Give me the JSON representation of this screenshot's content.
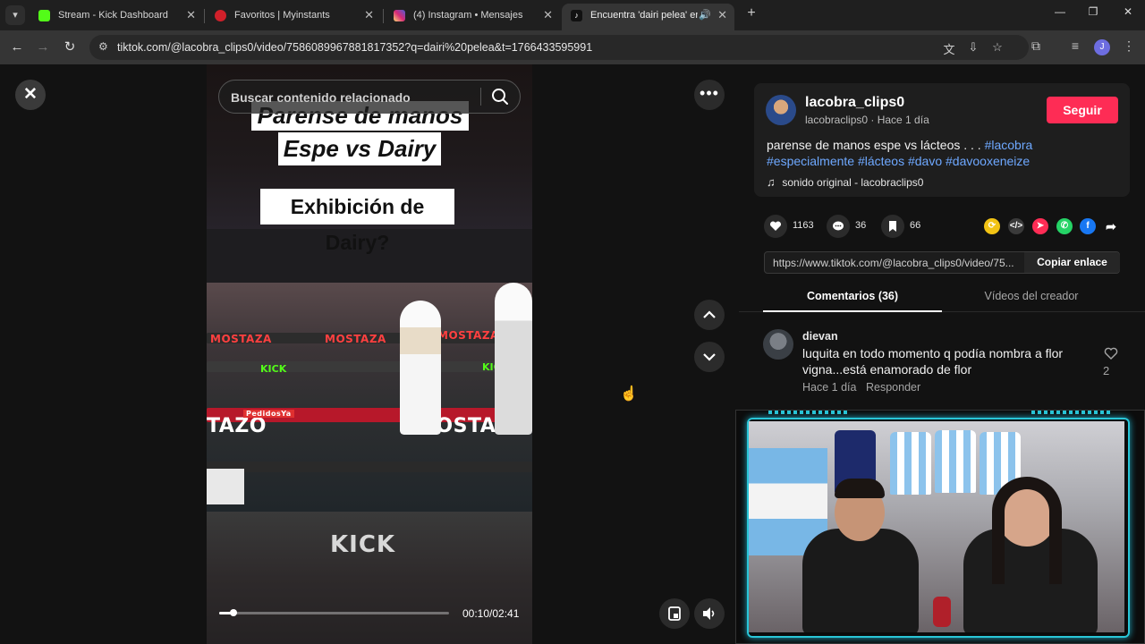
{
  "browser": {
    "tabs": [
      {
        "title": "Stream - Kick Dashboard",
        "color": "#53fc18"
      },
      {
        "title": "Favoritos | Myinstants",
        "color": "#d0202a"
      },
      {
        "title": "(4) Instagram • Mensajes",
        "color": "#d6249f"
      },
      {
        "title": "Encuentra 'dairi pelea' en Ti",
        "color": "#111111"
      }
    ],
    "url": "tiktok.com/@lacobra_clips0/video/7586089967881817352?q=dairi%20pelea&t=1766433595991"
  },
  "search": {
    "placeholder": "Buscar contenido relacionado"
  },
  "video": {
    "caption_line1": "Parense de manos",
    "caption_line2": "Espe vs Dairy",
    "caption_line3": "Exhibición de Dairy?",
    "brand_text": "MOSTAZA",
    "kick_text": "KICK",
    "sponsor_text": "PedidosYa",
    "current_time": "00:10",
    "duration": "02:41",
    "time_display": "00:10/02:41",
    "progress": 0.062
  },
  "author": {
    "username": "lacobra_clips0",
    "sub": "lacobraclips0 · Hace 1 día",
    "follow_label": "Seguir",
    "description_text": "parense de manos espe vs lácteos . . . ",
    "hashtags_line1": "#lacobra",
    "hashtags_line2": "#especialmente #lácteos #davo #davooxeneize",
    "sound": "sonido original - lacobraclips0"
  },
  "stats": {
    "likes": "1163",
    "comments": "36",
    "saves": "66"
  },
  "share": {
    "link": "https://www.tiktok.com/@lacobra_clips0/video/75...",
    "copy_label": "Copiar enlace",
    "icons": [
      {
        "name": "repost-icon",
        "color": "#f2c314"
      },
      {
        "name": "embed-icon",
        "color": "#3a3a3a"
      },
      {
        "name": "send-icon",
        "color": "#fe2c55"
      },
      {
        "name": "whatsapp-icon",
        "color": "#25d366"
      },
      {
        "name": "facebook-icon",
        "color": "#1877f2"
      }
    ]
  },
  "tabs": {
    "comments": "Comentarios (36)",
    "creator_videos": "Vídeos del creador"
  },
  "comment": {
    "user": "dievan",
    "text": "luquita en todo momento q podía nombra a flor vigna...está enamorado de flor",
    "time": "Hace 1 día",
    "reply": "Responder",
    "likes": "2"
  }
}
